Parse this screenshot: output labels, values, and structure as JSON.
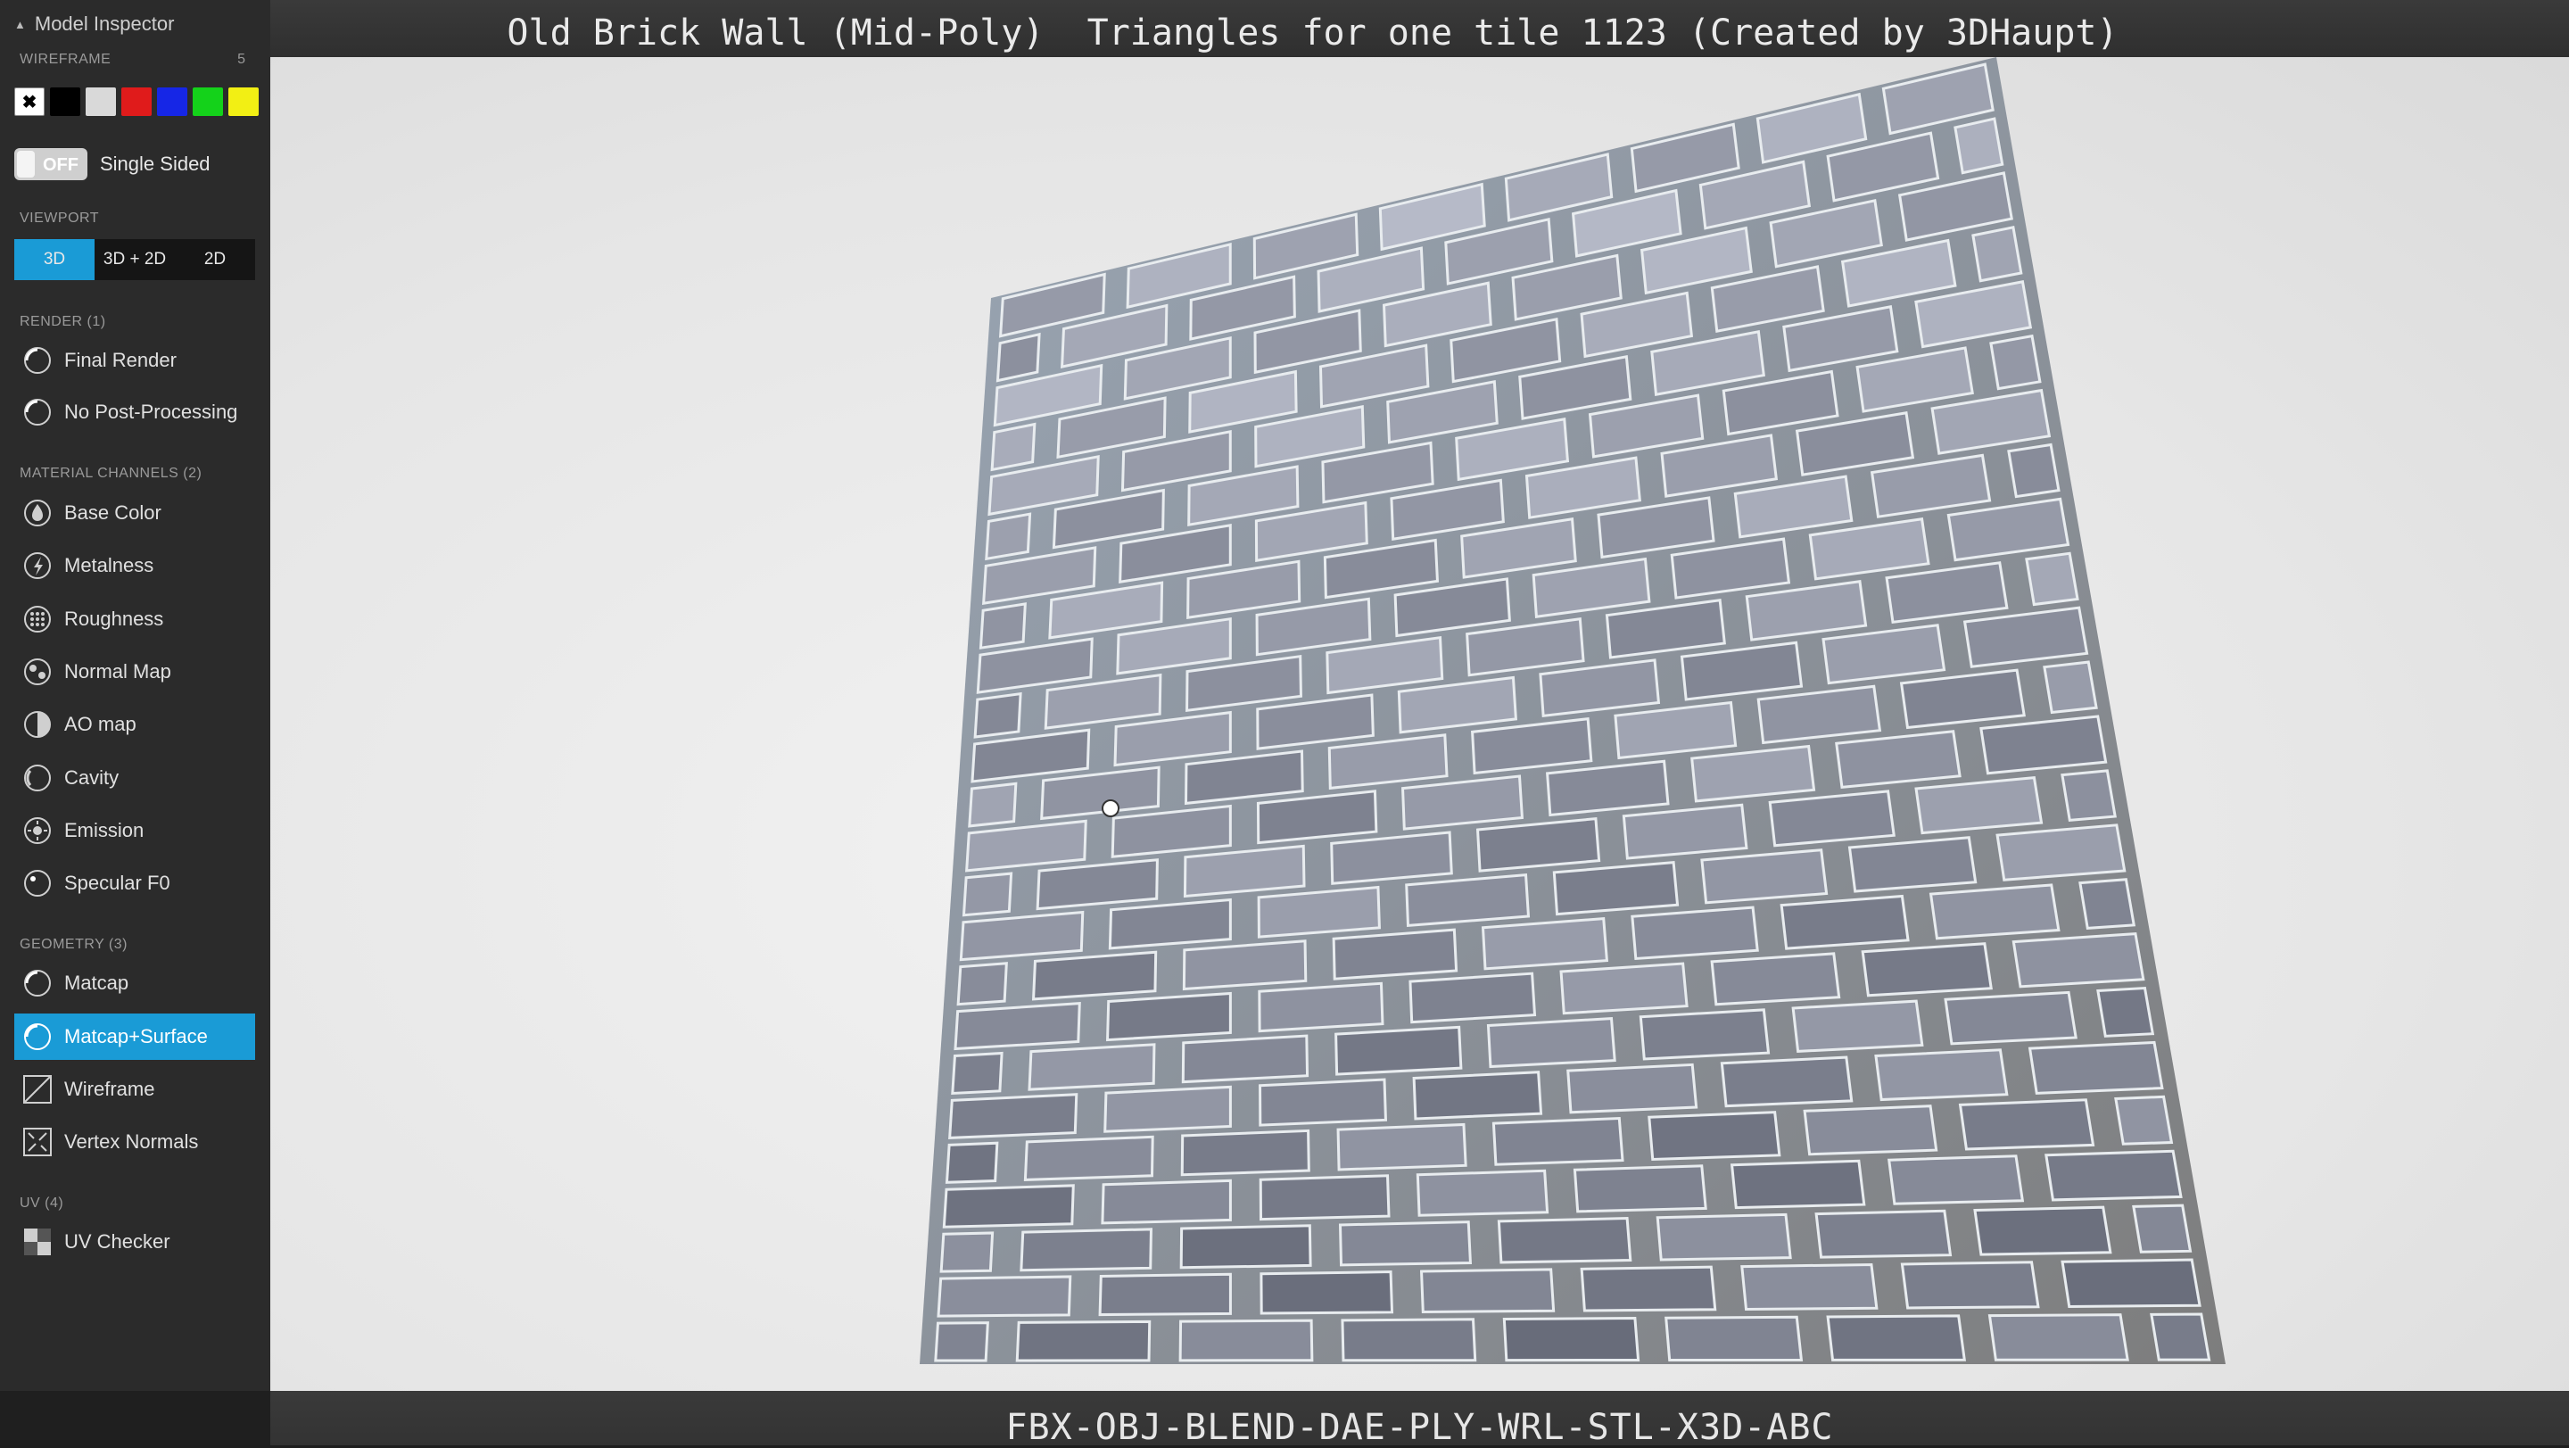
{
  "panel": {
    "title": "Model Inspector",
    "wireframe": {
      "label": "WIREFRAME",
      "count": "5",
      "swatches": [
        "#000000",
        "#d9d9d9",
        "#e01b1b",
        "#1626e6",
        "#14d21a",
        "#f2ef14"
      ]
    },
    "single_sided": {
      "state": "OFF",
      "label": "Single Sided"
    },
    "viewport": {
      "label": "VIEWPORT",
      "options": [
        "3D",
        "3D + 2D",
        "2D"
      ],
      "selected": "3D"
    },
    "render": {
      "label": "RENDER (1)",
      "items": [
        "Final Render",
        "No Post-Processing"
      ]
    },
    "material": {
      "label": "MATERIAL CHANNELS (2)",
      "items": [
        "Base Color",
        "Metalness",
        "Roughness",
        "Normal Map",
        "AO map",
        "Cavity",
        "Emission",
        "Specular F0"
      ]
    },
    "geometry": {
      "label": "GEOMETRY (3)",
      "items": [
        "Matcap",
        "Matcap+Surface",
        "Wireframe",
        "Vertex Normals"
      ],
      "selected": "Matcap+Surface"
    },
    "uv": {
      "label": "UV (4)",
      "items": [
        "UV Checker"
      ]
    }
  },
  "viewer": {
    "title": "Old Brick Wall (Mid-Poly)  Triangles for one tile 1123 (Created by 3DHaupt)",
    "formats": "FBX-OBJ-BLEND-DAE-PLY-WRL-STL-X3D-ABC"
  },
  "colors": {
    "accent": "#1a9bd6",
    "sidebar": "#2b2b2b"
  }
}
